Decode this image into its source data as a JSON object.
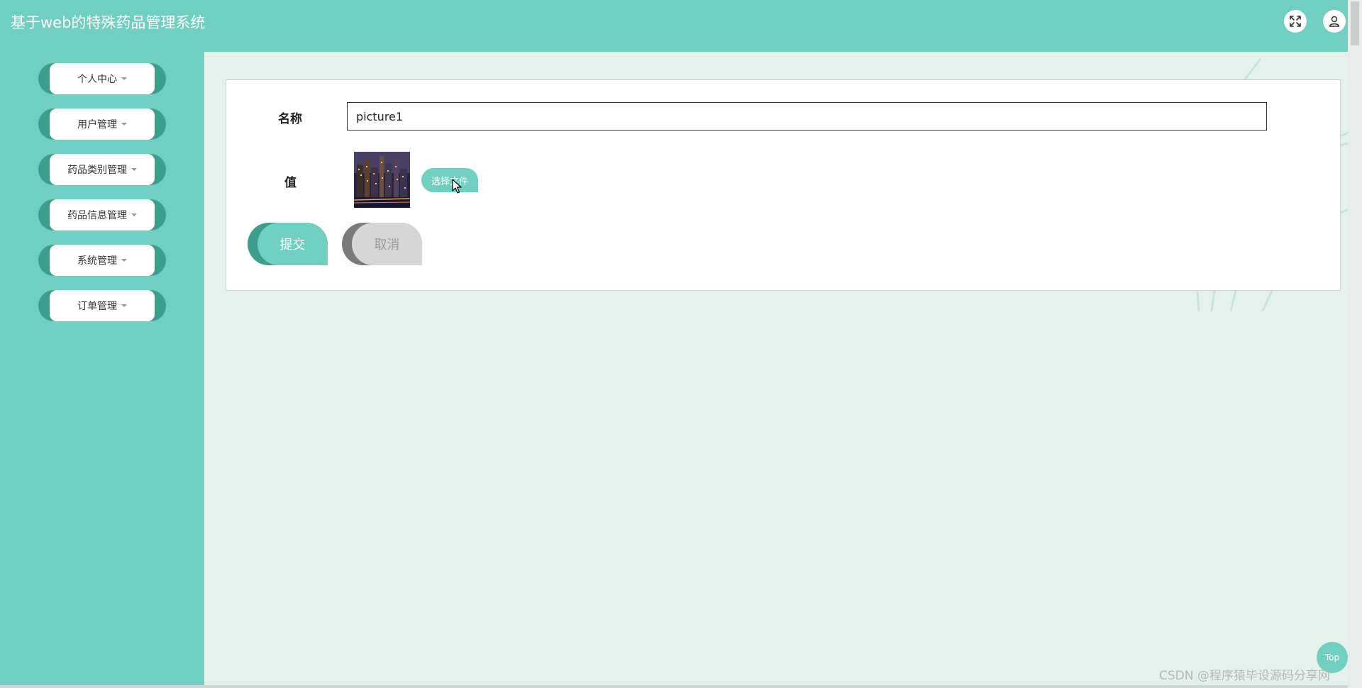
{
  "header": {
    "title": "基于web的特殊药品管理系统"
  },
  "sidebar": {
    "items": [
      {
        "label": "个人中心"
      },
      {
        "label": "用户管理"
      },
      {
        "label": "药品类别管理"
      },
      {
        "label": "药品信息管理"
      },
      {
        "label": "系统管理"
      },
      {
        "label": "订单管理"
      }
    ]
  },
  "form": {
    "name_label": "名称",
    "name_value": "picture1",
    "value_label": "值",
    "choose_file_label": "选择文件",
    "submit_label": "提交",
    "cancel_label": "取消"
  },
  "back_to_top_label": "Top",
  "watermark": "CSDN @程序猿毕设源码分享网",
  "colors": {
    "accent": "#70cfc0",
    "accent_dark": "#3d9e8d",
    "background": "#e5f2ec"
  },
  "icons": {
    "fullscreen": "fullscreen-icon",
    "user": "user-icon"
  }
}
